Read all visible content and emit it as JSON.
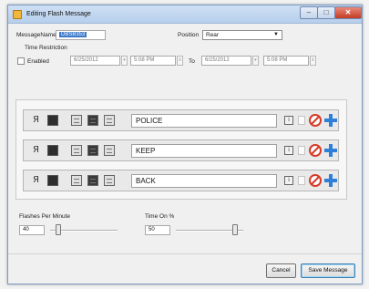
{
  "window": {
    "title": "Editing Flash Message"
  },
  "titlebar": {
    "minimize": "–",
    "maximize": "□",
    "close": "✕"
  },
  "form": {
    "message_name_label": "MessageName",
    "message_name_value": "DBSB353",
    "position_label": "Position",
    "position_value": "Rear",
    "time_restriction_label": "Time Restriction",
    "enabled_label": "Enabled",
    "enabled_checked": false,
    "start_date": "6/25/2012",
    "start_time": "5:08 PM",
    "to_label": "To",
    "end_date": "6/25/2012",
    "end_time": "5:08 PM"
  },
  "messages": [
    {
      "text": "POLICE"
    },
    {
      "text": "KEEP"
    },
    {
      "text": "BACK"
    }
  ],
  "row_controls": {
    "reverse_glyph": "Я",
    "info_glyph": "i"
  },
  "flashes": {
    "label": "Flashes Per Minute",
    "value": "40"
  },
  "time_on": {
    "label": "Time On %",
    "value": "50"
  },
  "buttons": {
    "cancel": "Cancel",
    "save": "Save Message"
  },
  "colors": {
    "accent": "#2f7fd8",
    "delete": "#d63a28",
    "selection": "#3b78c8"
  }
}
